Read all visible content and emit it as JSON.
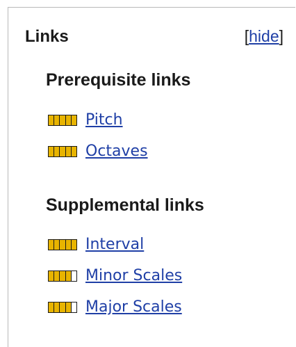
{
  "panel": {
    "title": "Links",
    "hide_open": "[",
    "hide_label": "hide",
    "hide_close": "]"
  },
  "prerequisite": {
    "title": "Prerequisite links",
    "items": [
      {
        "label": "Pitch",
        "level": 5
      },
      {
        "label": "Octaves",
        "level": 5
      }
    ]
  },
  "supplemental": {
    "title": "Supplemental links",
    "items": [
      {
        "label": "Interval",
        "level": 5
      },
      {
        "label": "Minor Scales",
        "level": 4
      },
      {
        "label": "Major Scales",
        "level": 4
      }
    ]
  },
  "colors": {
    "link": "#1f3fa6",
    "meter_fill": "#e8b400",
    "meter_border": "#1a1a1a"
  }
}
